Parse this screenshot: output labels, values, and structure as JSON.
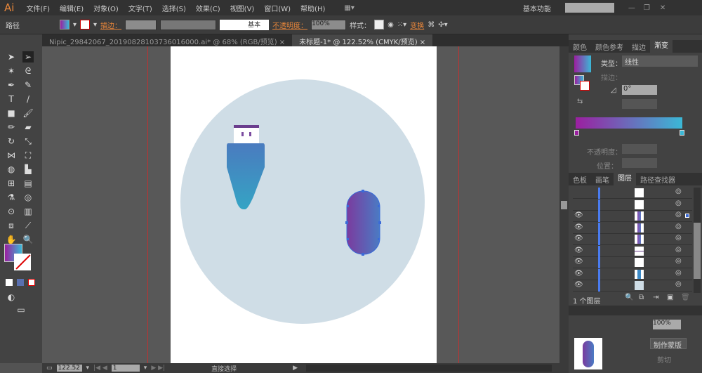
{
  "app": {
    "logo": "Ai",
    "workspace": "基本功能",
    "search_placeholder": ""
  },
  "menu": [
    "文件(F)",
    "编辑(E)",
    "对象(O)",
    "文字(T)",
    "选择(S)",
    "效果(C)",
    "视图(V)",
    "窗口(W)",
    "帮助(H)"
  ],
  "control": {
    "object_type": "路径",
    "stroke_label": "描边：",
    "brush_label": "基本",
    "opacity_label": "不透明度：",
    "opacity_value": "100%",
    "style_label": "样式：",
    "transform_label": "变换"
  },
  "tabs": [
    {
      "label": "Nipic_29842067_20190828103736016000.ai* @ 68% (RGB/预览)",
      "active": false
    },
    {
      "label": "未标题-1* @ 122.52% (CMYK/预览)",
      "active": true
    }
  ],
  "gradient_panel": {
    "tabs": [
      "颜色",
      "颜色参考",
      "描边",
      "渐变"
    ],
    "active": "渐变",
    "type_label": "类型：",
    "type_value": "线性",
    "stroke_label": "描边：",
    "angle_value": "0°",
    "opacity_label": "不透明度：",
    "position_label": "位置：",
    "start_color": "#9b1fa0",
    "end_color": "#3bb8d6"
  },
  "layers_panel": {
    "tabs": [
      "色板",
      "画笔",
      "图层",
      "路径查找器"
    ],
    "active": "图层",
    "footer": "1 个图层",
    "rows": [
      {
        "visible": false,
        "thumb": "blank"
      },
      {
        "visible": false,
        "thumb": "blank"
      },
      {
        "visible": true,
        "thumb": "pill",
        "selected": true
      },
      {
        "visible": true,
        "thumb": "bar"
      },
      {
        "visible": true,
        "thumb": "bar"
      },
      {
        "visible": true,
        "thumb": "line"
      },
      {
        "visible": true,
        "thumb": "blank"
      },
      {
        "visible": true,
        "thumb": "usb"
      },
      {
        "visible": true,
        "thumb": "circle"
      }
    ]
  },
  "transparency_panel": {
    "opacity_value": "100%",
    "make_mask_label": "制作蒙版",
    "clip_label": "剪切"
  },
  "status": {
    "zoom": "122.52",
    "page": "1",
    "tool": "直接选择"
  },
  "colors": {
    "circle": "#cfdde6",
    "usb_top": "#4a7bbf",
    "usb_bottom": "#35a4c4",
    "usb_cap": "#6b3e8e"
  }
}
